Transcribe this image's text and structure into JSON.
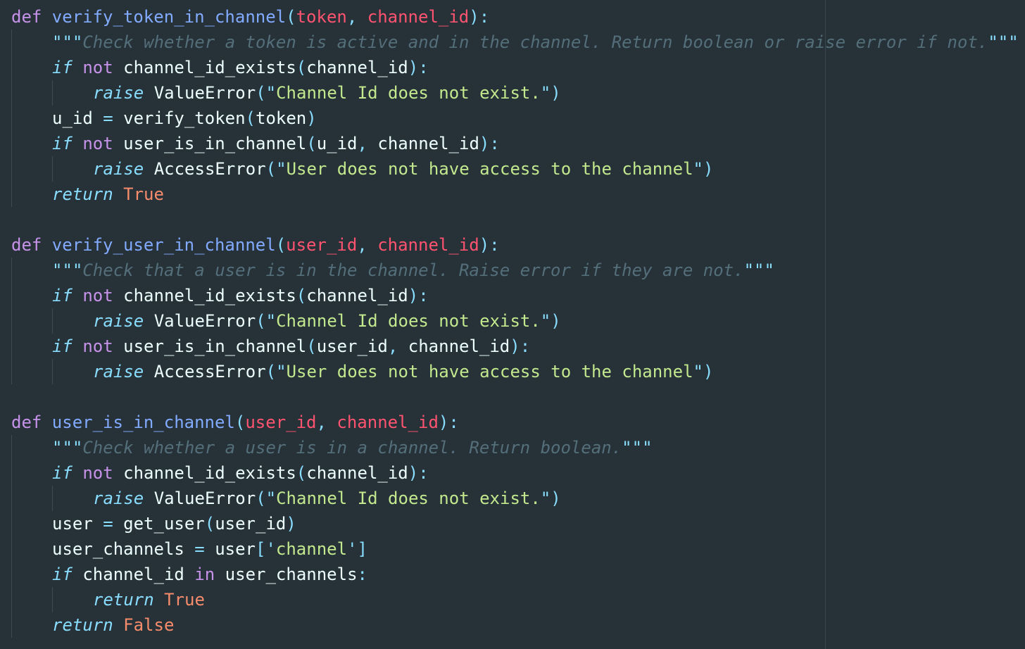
{
  "editor": {
    "language": "python",
    "theme_colors": {
      "background": "#263238",
      "keyword": "#c792ea",
      "control": "#89ddff",
      "function": "#82aaff",
      "parameter": "#ff5370",
      "punctuation": "#89ddff",
      "string": "#c3e88d",
      "comment": "#546e7a",
      "literal": "#f78c6c",
      "text": "#eeffff"
    },
    "lines": [
      {
        "indent": 0,
        "tokens": [
          [
            "kw",
            "def "
          ],
          [
            "fn",
            "verify_token_in_channel"
          ],
          [
            "pun",
            "("
          ],
          [
            "param",
            "token"
          ],
          [
            "pun",
            ", "
          ],
          [
            "param",
            "channel_id"
          ],
          [
            "pun",
            "):"
          ]
        ]
      },
      {
        "indent": 1,
        "tokens": [
          [
            "pun",
            "\"\"\""
          ],
          [
            "cmt",
            "Check whether a token is active and in the channel. Return boolean or raise error if not."
          ],
          [
            "pun",
            "\"\"\""
          ]
        ]
      },
      {
        "indent": 1,
        "tokens": [
          [
            "ctl",
            "if "
          ],
          [
            "kw",
            "not "
          ],
          [
            "plain",
            "channel_id_exists"
          ],
          [
            "pun",
            "("
          ],
          [
            "plain",
            "channel_id"
          ],
          [
            "pun",
            "):"
          ]
        ]
      },
      {
        "indent": 2,
        "tokens": [
          [
            "ctl",
            "raise "
          ],
          [
            "plain",
            "ValueError"
          ],
          [
            "pun",
            "(\""
          ],
          [
            "str",
            "Channel Id does not exist."
          ],
          [
            "pun",
            "\")"
          ]
        ]
      },
      {
        "indent": 1,
        "tokens": [
          [
            "plain",
            "u_id "
          ],
          [
            "pun",
            "= "
          ],
          [
            "plain",
            "verify_token"
          ],
          [
            "pun",
            "("
          ],
          [
            "plain",
            "token"
          ],
          [
            "pun",
            ")"
          ]
        ]
      },
      {
        "indent": 1,
        "tokens": [
          [
            "ctl",
            "if "
          ],
          [
            "kw",
            "not "
          ],
          [
            "plain",
            "user_is_in_channel"
          ],
          [
            "pun",
            "("
          ],
          [
            "plain",
            "u_id"
          ],
          [
            "pun",
            ", "
          ],
          [
            "plain",
            "channel_id"
          ],
          [
            "pun",
            "):"
          ]
        ]
      },
      {
        "indent": 2,
        "tokens": [
          [
            "ctl",
            "raise "
          ],
          [
            "plain",
            "AccessError"
          ],
          [
            "pun",
            "(\""
          ],
          [
            "str",
            "User does not have access to the channel"
          ],
          [
            "pun",
            "\")"
          ]
        ]
      },
      {
        "indent": 1,
        "tokens": [
          [
            "ctl",
            "return "
          ],
          [
            "lit",
            "True"
          ]
        ]
      },
      {
        "indent": 0,
        "tokens": []
      },
      {
        "indent": 0,
        "tokens": [
          [
            "kw",
            "def "
          ],
          [
            "fn",
            "verify_user_in_channel"
          ],
          [
            "pun",
            "("
          ],
          [
            "param",
            "user_id"
          ],
          [
            "pun",
            ", "
          ],
          [
            "param",
            "channel_id"
          ],
          [
            "pun",
            "):"
          ]
        ]
      },
      {
        "indent": 1,
        "tokens": [
          [
            "pun",
            "\"\"\""
          ],
          [
            "cmt",
            "Check that a user is in the channel. Raise error if they are not."
          ],
          [
            "pun",
            "\"\"\""
          ]
        ]
      },
      {
        "indent": 1,
        "tokens": [
          [
            "ctl",
            "if "
          ],
          [
            "kw",
            "not "
          ],
          [
            "plain",
            "channel_id_exists"
          ],
          [
            "pun",
            "("
          ],
          [
            "plain",
            "channel_id"
          ],
          [
            "pun",
            "):"
          ]
        ]
      },
      {
        "indent": 2,
        "tokens": [
          [
            "ctl",
            "raise "
          ],
          [
            "plain",
            "ValueError"
          ],
          [
            "pun",
            "(\""
          ],
          [
            "str",
            "Channel Id does not exist."
          ],
          [
            "pun",
            "\")"
          ]
        ]
      },
      {
        "indent": 1,
        "tokens": [
          [
            "ctl",
            "if "
          ],
          [
            "kw",
            "not "
          ],
          [
            "plain",
            "user_is_in_channel"
          ],
          [
            "pun",
            "("
          ],
          [
            "plain",
            "user_id"
          ],
          [
            "pun",
            ", "
          ],
          [
            "plain",
            "channel_id"
          ],
          [
            "pun",
            "):"
          ]
        ]
      },
      {
        "indent": 2,
        "tokens": [
          [
            "ctl",
            "raise "
          ],
          [
            "plain",
            "AccessError"
          ],
          [
            "pun",
            "(\""
          ],
          [
            "str",
            "User does not have access to the channel"
          ],
          [
            "pun",
            "\")"
          ]
        ]
      },
      {
        "indent": 0,
        "tokens": []
      },
      {
        "indent": 0,
        "tokens": [
          [
            "kw",
            "def "
          ],
          [
            "fn",
            "user_is_in_channel"
          ],
          [
            "pun",
            "("
          ],
          [
            "param",
            "user_id"
          ],
          [
            "pun",
            ", "
          ],
          [
            "param",
            "channel_id"
          ],
          [
            "pun",
            "):"
          ]
        ]
      },
      {
        "indent": 1,
        "tokens": [
          [
            "pun",
            "\"\"\""
          ],
          [
            "cmt",
            "Check whether a user is in a channel. Return boolean."
          ],
          [
            "pun",
            "\"\"\""
          ]
        ]
      },
      {
        "indent": 1,
        "tokens": [
          [
            "ctl",
            "if "
          ],
          [
            "kw",
            "not "
          ],
          [
            "plain",
            "channel_id_exists"
          ],
          [
            "pun",
            "("
          ],
          [
            "plain",
            "channel_id"
          ],
          [
            "pun",
            "):"
          ]
        ]
      },
      {
        "indent": 2,
        "tokens": [
          [
            "ctl",
            "raise "
          ],
          [
            "plain",
            "ValueError"
          ],
          [
            "pun",
            "(\""
          ],
          [
            "str",
            "Channel Id does not exist."
          ],
          [
            "pun",
            "\")"
          ]
        ]
      },
      {
        "indent": 1,
        "tokens": [
          [
            "plain",
            "user "
          ],
          [
            "pun",
            "= "
          ],
          [
            "plain",
            "get_user"
          ],
          [
            "pun",
            "("
          ],
          [
            "plain",
            "user_id"
          ],
          [
            "pun",
            ")"
          ]
        ]
      },
      {
        "indent": 1,
        "tokens": [
          [
            "plain",
            "user_channels "
          ],
          [
            "pun",
            "= "
          ],
          [
            "plain",
            "user"
          ],
          [
            "pun",
            "['"
          ],
          [
            "str",
            "channel"
          ],
          [
            "pun",
            "']"
          ]
        ]
      },
      {
        "indent": 1,
        "tokens": [
          [
            "ctl",
            "if "
          ],
          [
            "plain",
            "channel_id "
          ],
          [
            "kw",
            "in "
          ],
          [
            "plain",
            "user_channels"
          ],
          [
            "pun",
            ":"
          ]
        ]
      },
      {
        "indent": 2,
        "tokens": [
          [
            "ctl",
            "return "
          ],
          [
            "lit",
            "True"
          ]
        ]
      },
      {
        "indent": 1,
        "tokens": [
          [
            "ctl",
            "return "
          ],
          [
            "lit",
            "False"
          ]
        ]
      }
    ]
  }
}
